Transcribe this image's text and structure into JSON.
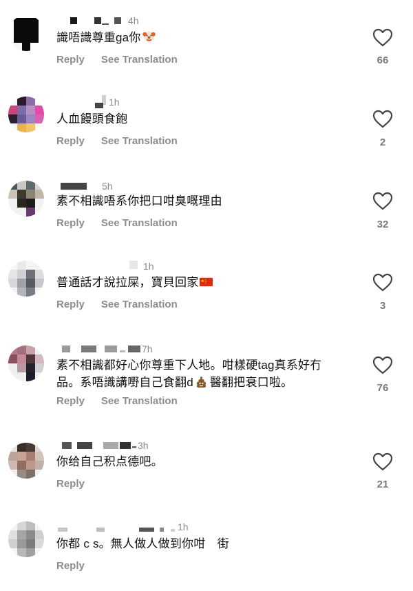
{
  "comments": [
    {
      "age": "4h",
      "text": "識唔識尊重ga你",
      "emoji": "clown-face-emoji",
      "reply": "Reply",
      "translate": "See Translation",
      "likes": "66"
    },
    {
      "age": "1h",
      "text": "人血饅頭食飽",
      "reply": "Reply",
      "translate": "See Translation",
      "likes": "2"
    },
    {
      "age": "5h",
      "text": "素不相識唔系你把口咁臭嘅理由",
      "reply": "Reply",
      "translate": "See Translation",
      "likes": "32"
    },
    {
      "age": "1h",
      "text": "普通話才說拉屎，寶貝回家",
      "emoji": "china-flag-emoji",
      "reply": "Reply",
      "translate": "See Translation",
      "likes": "3"
    },
    {
      "age": "7h",
      "text_line1": "素不相識都好心你尊重下人地。咁樣硬tag真系好冇",
      "text_line2a": "品。系唔識講嘢自己食翻d",
      "emoji": "poop-emoji",
      "text_line2b": "醫翻把衰口啦。",
      "reply": "Reply",
      "translate": "See Translation",
      "likes": "76"
    },
    {
      "age": "3h",
      "text": "你给自己积点德吧。",
      "reply": "Reply",
      "likes": "21"
    },
    {
      "age": "1h",
      "text": "你都 c s。無人做人做到你咁　街",
      "reply": "Reply"
    }
  ],
  "colors": {
    "secondary_text": "#8c8c8c",
    "primary_text": "#111111",
    "heart_outline": "#444444"
  },
  "icons": {
    "like": "heart-outline-icon"
  }
}
